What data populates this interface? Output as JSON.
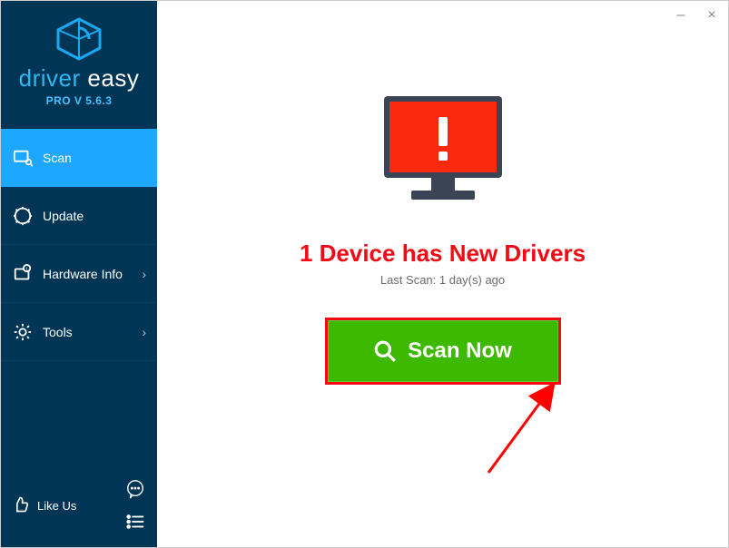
{
  "brand": {
    "name1": "driver",
    "name2": " easy",
    "version": "PRO V 5.6.3"
  },
  "nav": {
    "scan": "Scan",
    "update": "Update",
    "hardware": "Hardware Info",
    "tools": "Tools"
  },
  "bottom": {
    "like": "Like Us"
  },
  "main": {
    "headline": "1 Device has New Drivers",
    "subtext": "Last Scan: 1 day(s) ago",
    "scan_button": "Scan Now"
  },
  "window": {
    "minimize": "–",
    "close": "×"
  },
  "colors": {
    "accent": "#1ea7ff",
    "sidebar": "#003556",
    "alert": "#f40813",
    "green": "#3db900"
  }
}
